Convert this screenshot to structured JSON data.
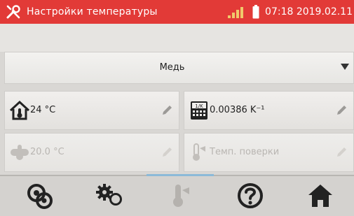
{
  "header": {
    "title": "Настройки температуры",
    "datetime": "07:18 2019.02.11",
    "icons": [
      "wrench-icon",
      "signal-icon",
      "battery-icon"
    ]
  },
  "material": {
    "selected": "Медь"
  },
  "tiles": [
    {
      "name": "ambient-temperature",
      "value": "24 °C",
      "icon": "house-thermometer-icon",
      "enabled": true
    },
    {
      "name": "temperature-coefficient",
      "value": "0.00386 K⁻¹",
      "icon": "coefficient-calculator-icon",
      "enabled": true
    },
    {
      "name": "reference-temperature",
      "value": "20.0 °C",
      "icon": "reference-temperature-icon",
      "enabled": false
    },
    {
      "name": "calibration-temperature",
      "value": "Темп. поверки",
      "icon": "thermometer-flag-icon",
      "enabled": false
    }
  ],
  "toolbar": {
    "buttons": [
      "meters-icon",
      "settings-icon",
      "thermometer-icon",
      "help-icon",
      "home-icon"
    ]
  },
  "colors": {
    "header": "#e23a37",
    "accent": "#8cbad8",
    "text": "#222222",
    "disabled_text": "#b9b6b2"
  }
}
